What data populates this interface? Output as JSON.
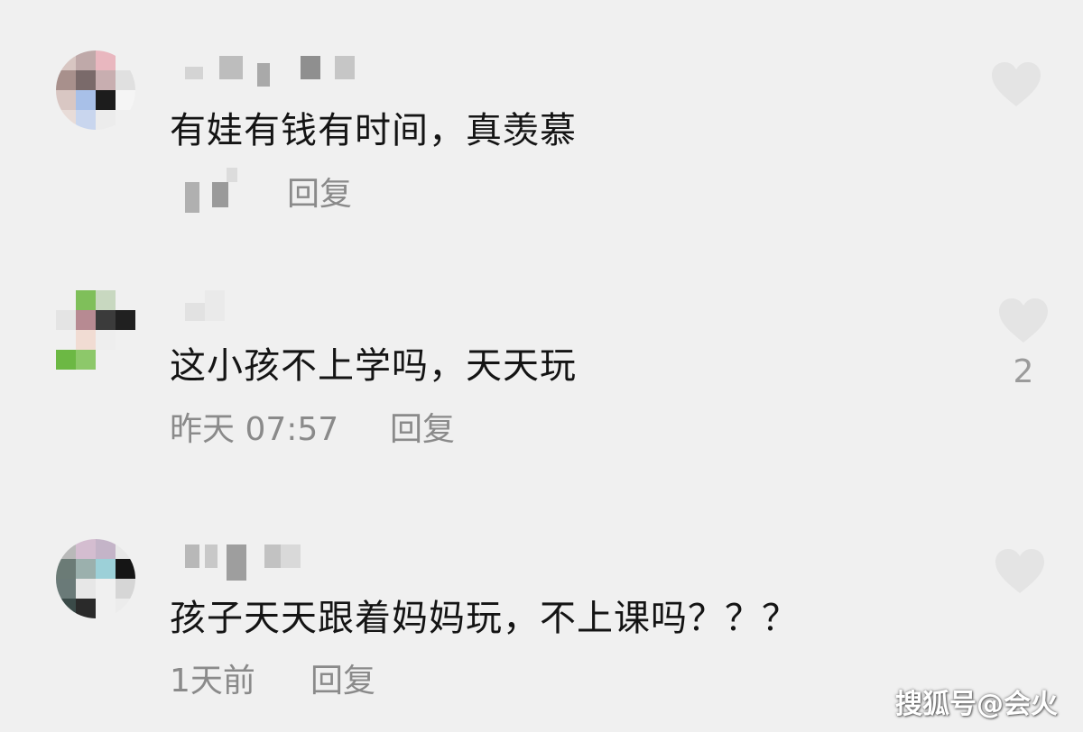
{
  "comments": [
    {
      "text": "有娃有钱有时间，真羡慕",
      "time": "",
      "reply_label": "回复",
      "like_count": ""
    },
    {
      "text": "这小孩不上学吗，天天玩",
      "time": "昨天 07:57",
      "reply_label": "回复",
      "like_count": "2"
    },
    {
      "text": "孩子天天跟着妈妈玩，不上课吗？？？",
      "time": "1天前",
      "reply_label": "回复",
      "like_count": ""
    }
  ],
  "watermark": "搜狐号@会火",
  "colors": {
    "background": "#f0f0f0",
    "text": "#141414",
    "meta": "#8a8a8a",
    "heart": "#e4e4e4"
  },
  "icons": {
    "like": "heart-icon"
  }
}
